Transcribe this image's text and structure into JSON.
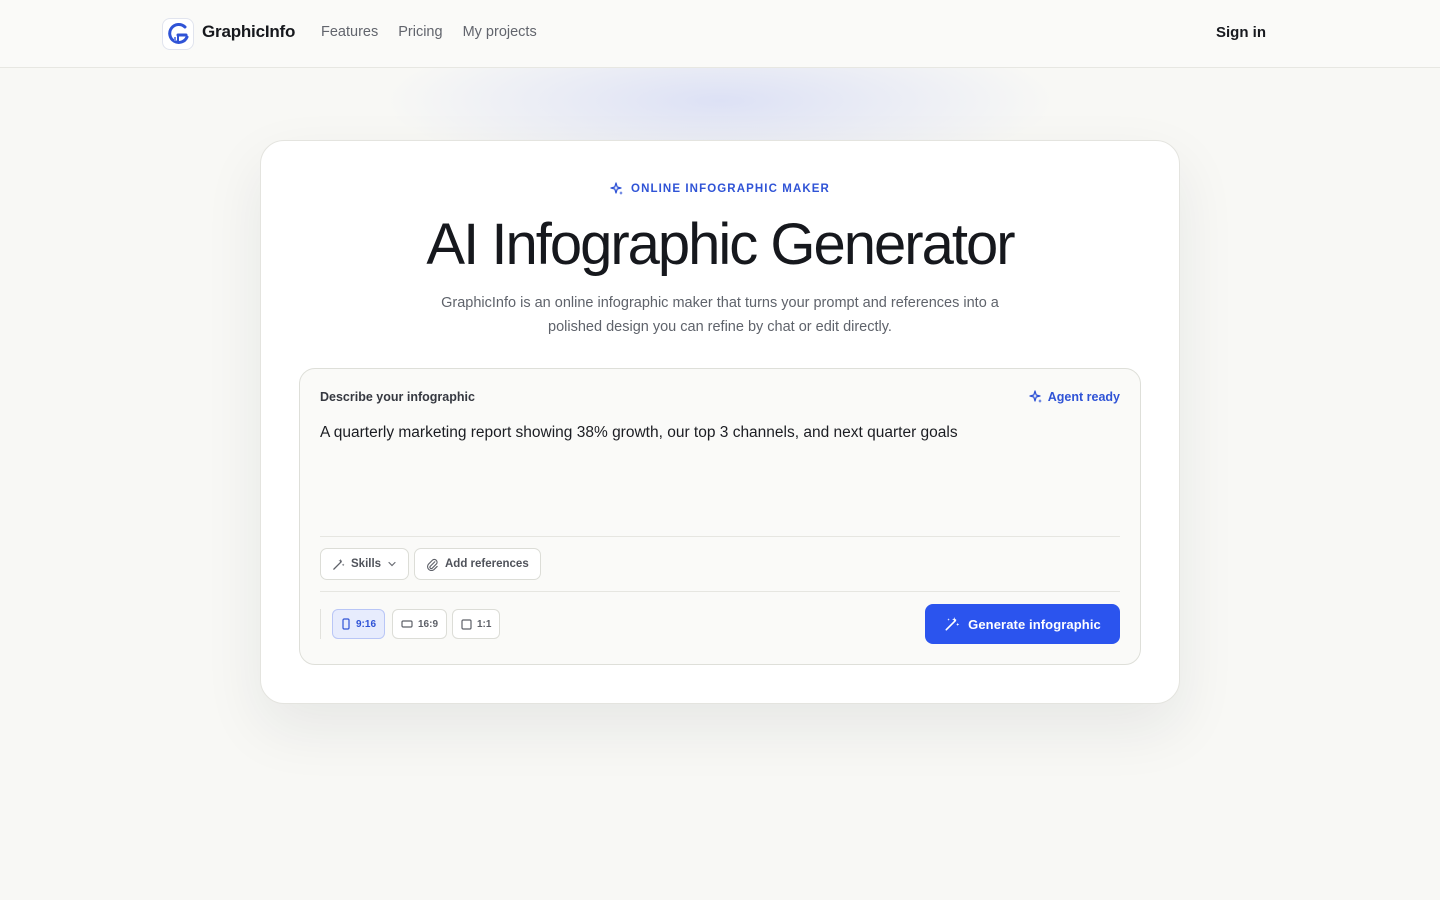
{
  "header": {
    "brand": "GraphicInfo",
    "nav": [
      {
        "label": "Features"
      },
      {
        "label": "Pricing"
      },
      {
        "label": "My projects"
      }
    ],
    "sign_in": "Sign in"
  },
  "hero": {
    "eyebrow": "ONLINE INFOGRAPHIC MAKER",
    "title": "AI Infographic Generator",
    "subtitle": "GraphicInfo is an online infographic maker that turns your prompt and references into a polished design you can refine by chat or edit directly."
  },
  "prompt": {
    "label": "Describe your infographic",
    "agent_status": "Agent ready",
    "value": "A quarterly marketing report showing 38% growth, our top 3 channels, and next quarter goals"
  },
  "tools": {
    "skills": "Skills",
    "add_references": "Add references"
  },
  "ratios": [
    {
      "label": "9:16",
      "selected": true
    },
    {
      "label": "16:9",
      "selected": false
    },
    {
      "label": "1:1",
      "selected": false
    }
  ],
  "generate_label": "Generate infographic",
  "colors": {
    "accent": "#2b54ee",
    "accent_text": "#2f53d6",
    "background": "#f8f8f5"
  }
}
